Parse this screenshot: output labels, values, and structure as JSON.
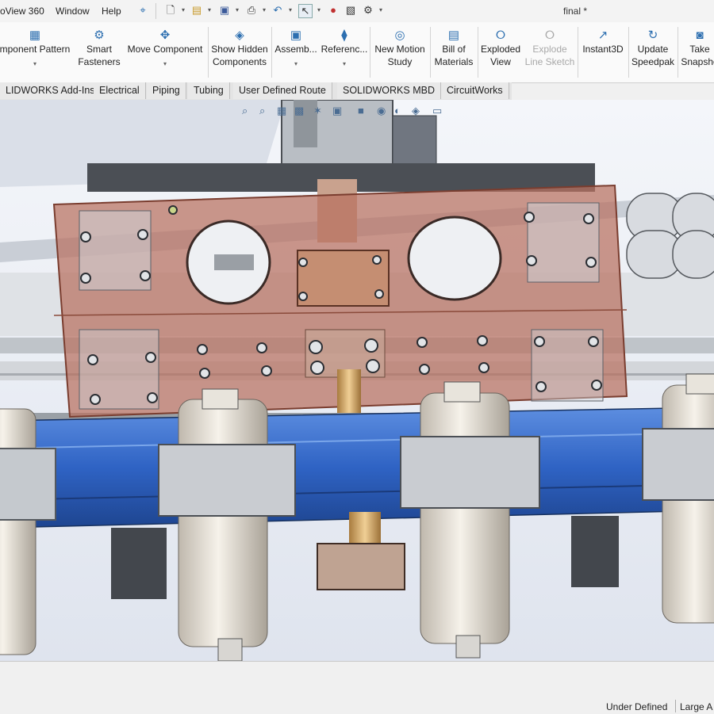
{
  "menu": {
    "items": [
      "oView 360",
      "Window",
      "Help"
    ]
  },
  "document": {
    "title": "final *"
  },
  "command_manager": {
    "buttons": [
      {
        "label1": "mponent Pattern",
        "label2": "",
        "icon": "component-pattern-icon"
      },
      {
        "label1": "Smart",
        "label2": "Fasteners",
        "icon": "smart-fasteners-icon"
      },
      {
        "label1": "Move Component",
        "label2": "",
        "icon": "move-component-icon"
      },
      {
        "label1": "Show Hidden",
        "label2": "Components",
        "icon": "show-hidden-components-icon"
      },
      {
        "label1": "Assemb...",
        "label2": "",
        "icon": "assembly-features-icon"
      },
      {
        "label1": "Referenc...",
        "label2": "",
        "icon": "reference-geometry-icon"
      },
      {
        "label1": "New Motion",
        "label2": "Study",
        "icon": "motion-study-icon"
      },
      {
        "label1": "Bill of",
        "label2": "Materials",
        "icon": "bill-of-materials-icon"
      },
      {
        "label1": "Exploded",
        "label2": "View",
        "icon": "exploded-view-icon"
      },
      {
        "label1": "Explode",
        "label2": "Line Sketch",
        "icon": "explode-line-sketch-icon"
      },
      {
        "label1": "Instant3D",
        "label2": "",
        "icon": "instant3d-icon"
      },
      {
        "label1": "Update",
        "label2": "Speedpak",
        "icon": "update-speedpak-icon"
      },
      {
        "label1": "Take",
        "label2": "Snapsho",
        "icon": "take-snapshot-icon"
      }
    ]
  },
  "tabs": [
    "LIDWORKS Add-Ins",
    "Electrical",
    "Piping",
    "Tubing",
    "User Defined Route",
    "SOLIDWORKS MBD",
    "CircuitWorks"
  ],
  "status": {
    "state": "Under Defined",
    "extra": "Large A"
  },
  "colors": {
    "transparent_plate": "#b8705f",
    "beam": "#2f63c4",
    "spindle": "#ece6dc",
    "lead_screw": "#d4a868"
  }
}
